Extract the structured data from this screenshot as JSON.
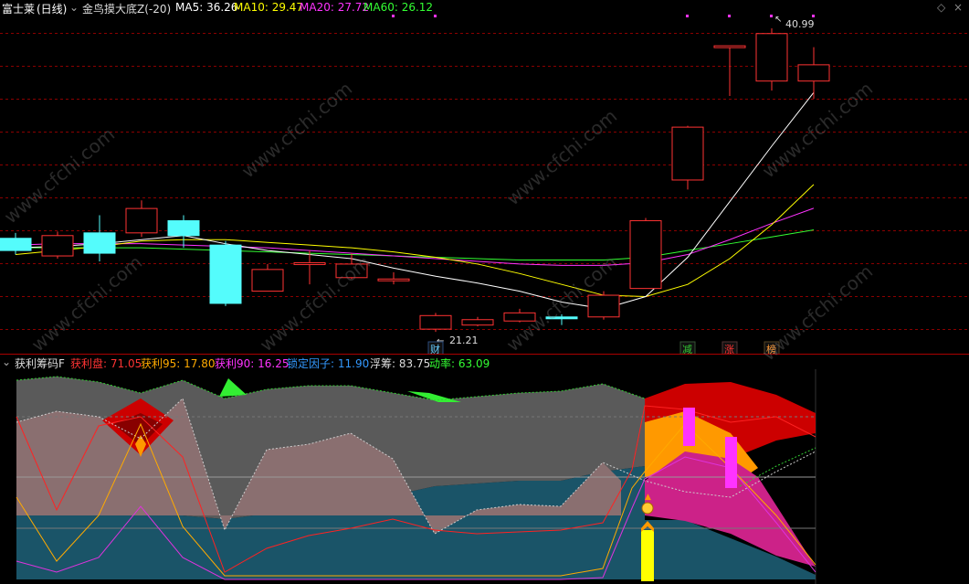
{
  "main_panel": {
    "stock_name": "富士莱",
    "period": "(日线)",
    "indicator": "金鸟摸大底Z(-20)",
    "ma": [
      {
        "label": "MA5:",
        "value": "36.26",
        "color": "#ffffff"
      },
      {
        "label": "MA10:",
        "value": "29.47",
        "color": "#ffff00"
      },
      {
        "label": "MA20:",
        "value": "27.72",
        "color": "#ff33ff"
      },
      {
        "label": "MA60:",
        "value": "26.12",
        "color": "#33ff33"
      }
    ],
    "high_label": "40.99",
    "low_label": "21.21",
    "markers": [
      {
        "text": "财",
        "color": "#66ccff"
      },
      {
        "text": "减",
        "color": "#33cc33"
      },
      {
        "text": "涨",
        "color": "#ff3333"
      },
      {
        "text": "榜",
        "color": "#ff9933"
      }
    ],
    "watermark": "www.cfchi.com",
    "candles": [
      {
        "o": 25.5,
        "c": 24.6,
        "h": 25.9,
        "l": 24.3
      },
      {
        "o": 24.2,
        "c": 25.7,
        "h": 26.0,
        "l": 24.0
      },
      {
        "o": 25.9,
        "c": 24.4,
        "h": 27.2,
        "l": 23.8
      },
      {
        "o": 25.9,
        "c": 27.7,
        "h": 28.3,
        "l": 25.6
      },
      {
        "o": 26.8,
        "c": 25.7,
        "h": 27.2,
        "l": 24.8
      },
      {
        "o": 25.0,
        "c": 20.7,
        "h": 25.3,
        "l": 20.5
      },
      {
        "o": 21.6,
        "c": 23.2,
        "h": 23.6,
        "l": 21.6
      },
      {
        "o": 23.7,
        "c": 23.7,
        "h": 24.6,
        "l": 22.1
      },
      {
        "o": 22.6,
        "c": 23.6,
        "h": 24.4,
        "l": 22.5
      },
      {
        "o": 22.5,
        "c": 22.5,
        "h": 23.0,
        "l": 22.1
      },
      {
        "o": 18.8,
        "c": 19.8,
        "h": 20.0,
        "l": 18.6
      },
      {
        "o": 19.1,
        "c": 19.5,
        "h": 19.7,
        "l": 19.0
      },
      {
        "o": 19.4,
        "c": 20.0,
        "h": 20.3,
        "l": 19.3
      },
      {
        "o": 19.7,
        "c": 19.6,
        "h": 19.9,
        "l": 19.1
      },
      {
        "o": 19.7,
        "c": 21.3,
        "h": 21.6,
        "l": 19.5
      },
      {
        "o": 21.8,
        "c": 26.8,
        "h": 27.0,
        "l": 21.8
      },
      {
        "o": 29.8,
        "c": 33.7,
        "h": 33.8,
        "l": 29.1
      },
      {
        "o": 39.7,
        "c": 39.7,
        "h": 39.7,
        "l": 36.0
      },
      {
        "o": 37.1,
        "c": 40.6,
        "h": 40.99,
        "l": 36.4
      },
      {
        "o": 37.1,
        "c": 38.3,
        "h": 39.6,
        "l": 35.8
      }
    ],
    "ma5": [
      24.8,
      24.9,
      25.1,
      25.4,
      25.7,
      25.1,
      24.6,
      24.3,
      24.0,
      23.3,
      22.7,
      22.2,
      21.6,
      20.8,
      20.3,
      21.2,
      24.1,
      28.2,
      32.3,
      36.26
    ],
    "ma10": [
      24.3,
      24.6,
      24.9,
      25.3,
      25.4,
      25.4,
      25.2,
      25.0,
      24.8,
      24.5,
      24.1,
      23.6,
      22.9,
      22.1,
      21.3,
      21.2,
      22.1,
      24.0,
      26.5,
      29.47
    ],
    "ma20": [
      25.0,
      25.1,
      25.1,
      25.1,
      25.0,
      24.9,
      24.8,
      24.6,
      24.4,
      24.2,
      24.0,
      23.8,
      23.6,
      23.5,
      23.5,
      23.7,
      24.3,
      25.4,
      26.6,
      27.72
    ],
    "ma60": [
      24.8,
      24.8,
      24.8,
      24.8,
      24.7,
      24.6,
      24.5,
      24.4,
      24.3,
      24.2,
      24.1,
      24.0,
      23.9,
      23.9,
      23.9,
      24.1,
      24.6,
      25.1,
      25.6,
      26.12
    ]
  },
  "sub_panel": {
    "title": "获利筹码F",
    "items": [
      {
        "label": "获利盘:",
        "value": "71.05",
        "color": "#ff3333"
      },
      {
        "label": "获利95:",
        "value": "17.80",
        "color": "#ffaa00"
      },
      {
        "label": "获利90:",
        "value": "16.25",
        "color": "#ff33ff"
      },
      {
        "label": "锁定因子:",
        "value": "11.90",
        "color": "#3399ff"
      },
      {
        "label": "浮筹:",
        "value": "83.75",
        "color": "#dddddd"
      },
      {
        "label": "动率:",
        "value": "63.09",
        "color": "#33ff33"
      }
    ]
  },
  "colors": {
    "up": "#ff3333",
    "down": "#54fcfc",
    "grid": "#8b0000"
  }
}
